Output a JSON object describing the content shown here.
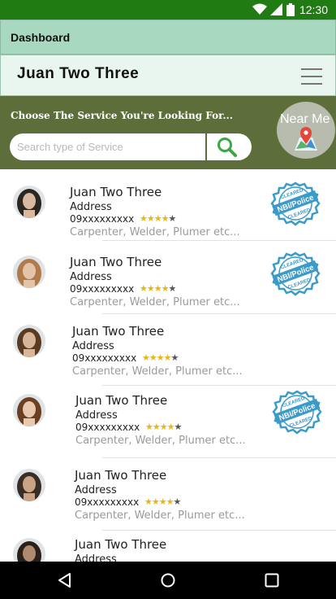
{
  "status_bar": {
    "time": "12:30"
  },
  "dashboard": {
    "label": "Dashboard"
  },
  "header": {
    "title": "Juan Two Three"
  },
  "search": {
    "prompt": "Choose The Service You're Looking For...",
    "placeholder": "Search type of Service",
    "near_me_label": "Near Me"
  },
  "workers": [
    {
      "name": "Juan Two Three",
      "address": "Address",
      "phone": "09xxxxxxxxx",
      "rating": 4,
      "rating_max": 5,
      "skills": "Carpenter, Welder, Plumer etc...",
      "badge": true
    },
    {
      "name": "Juan Two Three",
      "address": "Address",
      "phone": "09xxxxxxxxx",
      "rating": 4,
      "rating_max": 5,
      "skills": "Carpenter, Welder, Plumer etc...",
      "badge": true
    },
    {
      "name": "Juan Two Three",
      "address": "Address",
      "phone": "09xxxxxxxxx",
      "rating": 4,
      "rating_max": 5,
      "skills": "Carpenter, Welder, Plumer etc...",
      "badge": false
    },
    {
      "name": "Juan Two Three",
      "address": "Address",
      "phone": "09xxxxxxxxx",
      "rating": 4,
      "rating_max": 5,
      "skills": "Carpenter, Welder, Plumer etc...",
      "badge": true
    },
    {
      "name": "Juan Two Three",
      "address": "Address",
      "phone": "09xxxxxxxxx",
      "rating": 4,
      "rating_max": 5,
      "skills": "Carpenter, Welder, Plumer etc...",
      "badge": false
    },
    {
      "name": "Juan Two Three",
      "address": "Address",
      "phone": "",
      "rating": 0,
      "rating_max": 0,
      "skills": "",
      "badge": false
    }
  ],
  "badge": {
    "top_text": "CLEARED",
    "main_text": "NBI/Police",
    "bottom_text": "CLEARED"
  },
  "icons": {
    "wifi": "wifi-icon",
    "signal": "signal-icon",
    "battery": "battery-icon",
    "menu": "hamburger-menu-icon",
    "search": "search-icon",
    "map": "map-pin-icon",
    "back": "back-icon",
    "home": "home-icon",
    "recents": "recents-icon"
  },
  "colors": {
    "status_bar": "#1f7b12",
    "dashboard_bar": "#a8d8bf",
    "title_bar": "#e9f6ef",
    "search_band": "#5e6e3a",
    "badge_blue": "#3b9ac8",
    "star": "#e8b514"
  }
}
